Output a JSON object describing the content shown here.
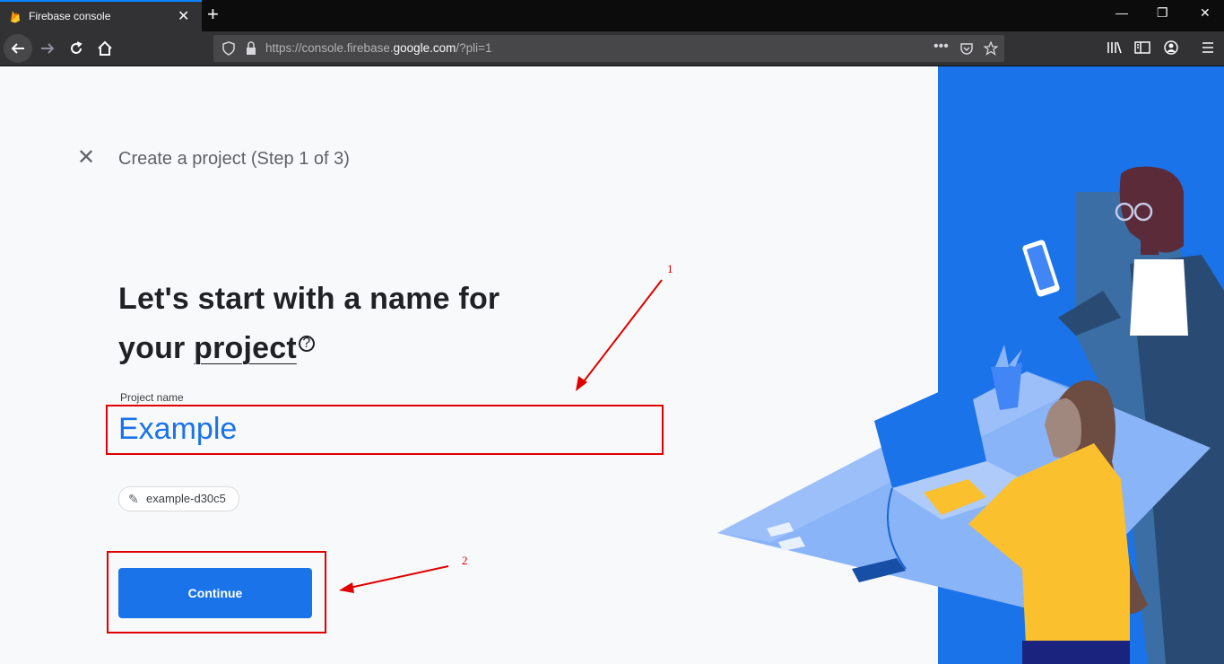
{
  "browser": {
    "tab_title": "Firebase console",
    "tab_close": "✕",
    "new_tab": "+",
    "url_prefix": "https://console.firebase.",
    "url_domain": "google.com",
    "url_suffix": "/?pli=1",
    "window_minimize": "—",
    "window_restore": "❐",
    "window_close": "✕"
  },
  "page": {
    "close_glyph": "✕",
    "step_title": "Create a project (Step 1 of 3)",
    "headline_part1": "Let's start with a name for",
    "headline_part2": "your ",
    "headline_link": "project",
    "help_glyph": "?",
    "field_label": "Project name",
    "field_value": "Example",
    "project_id": "example-d30c5",
    "continue_label": "Continue"
  },
  "annotations": {
    "num1": "1",
    "num2": "2",
    "color": "#e00000"
  },
  "colors": {
    "accent": "#1a73e8",
    "illustration_bg": "#1a73e8"
  }
}
